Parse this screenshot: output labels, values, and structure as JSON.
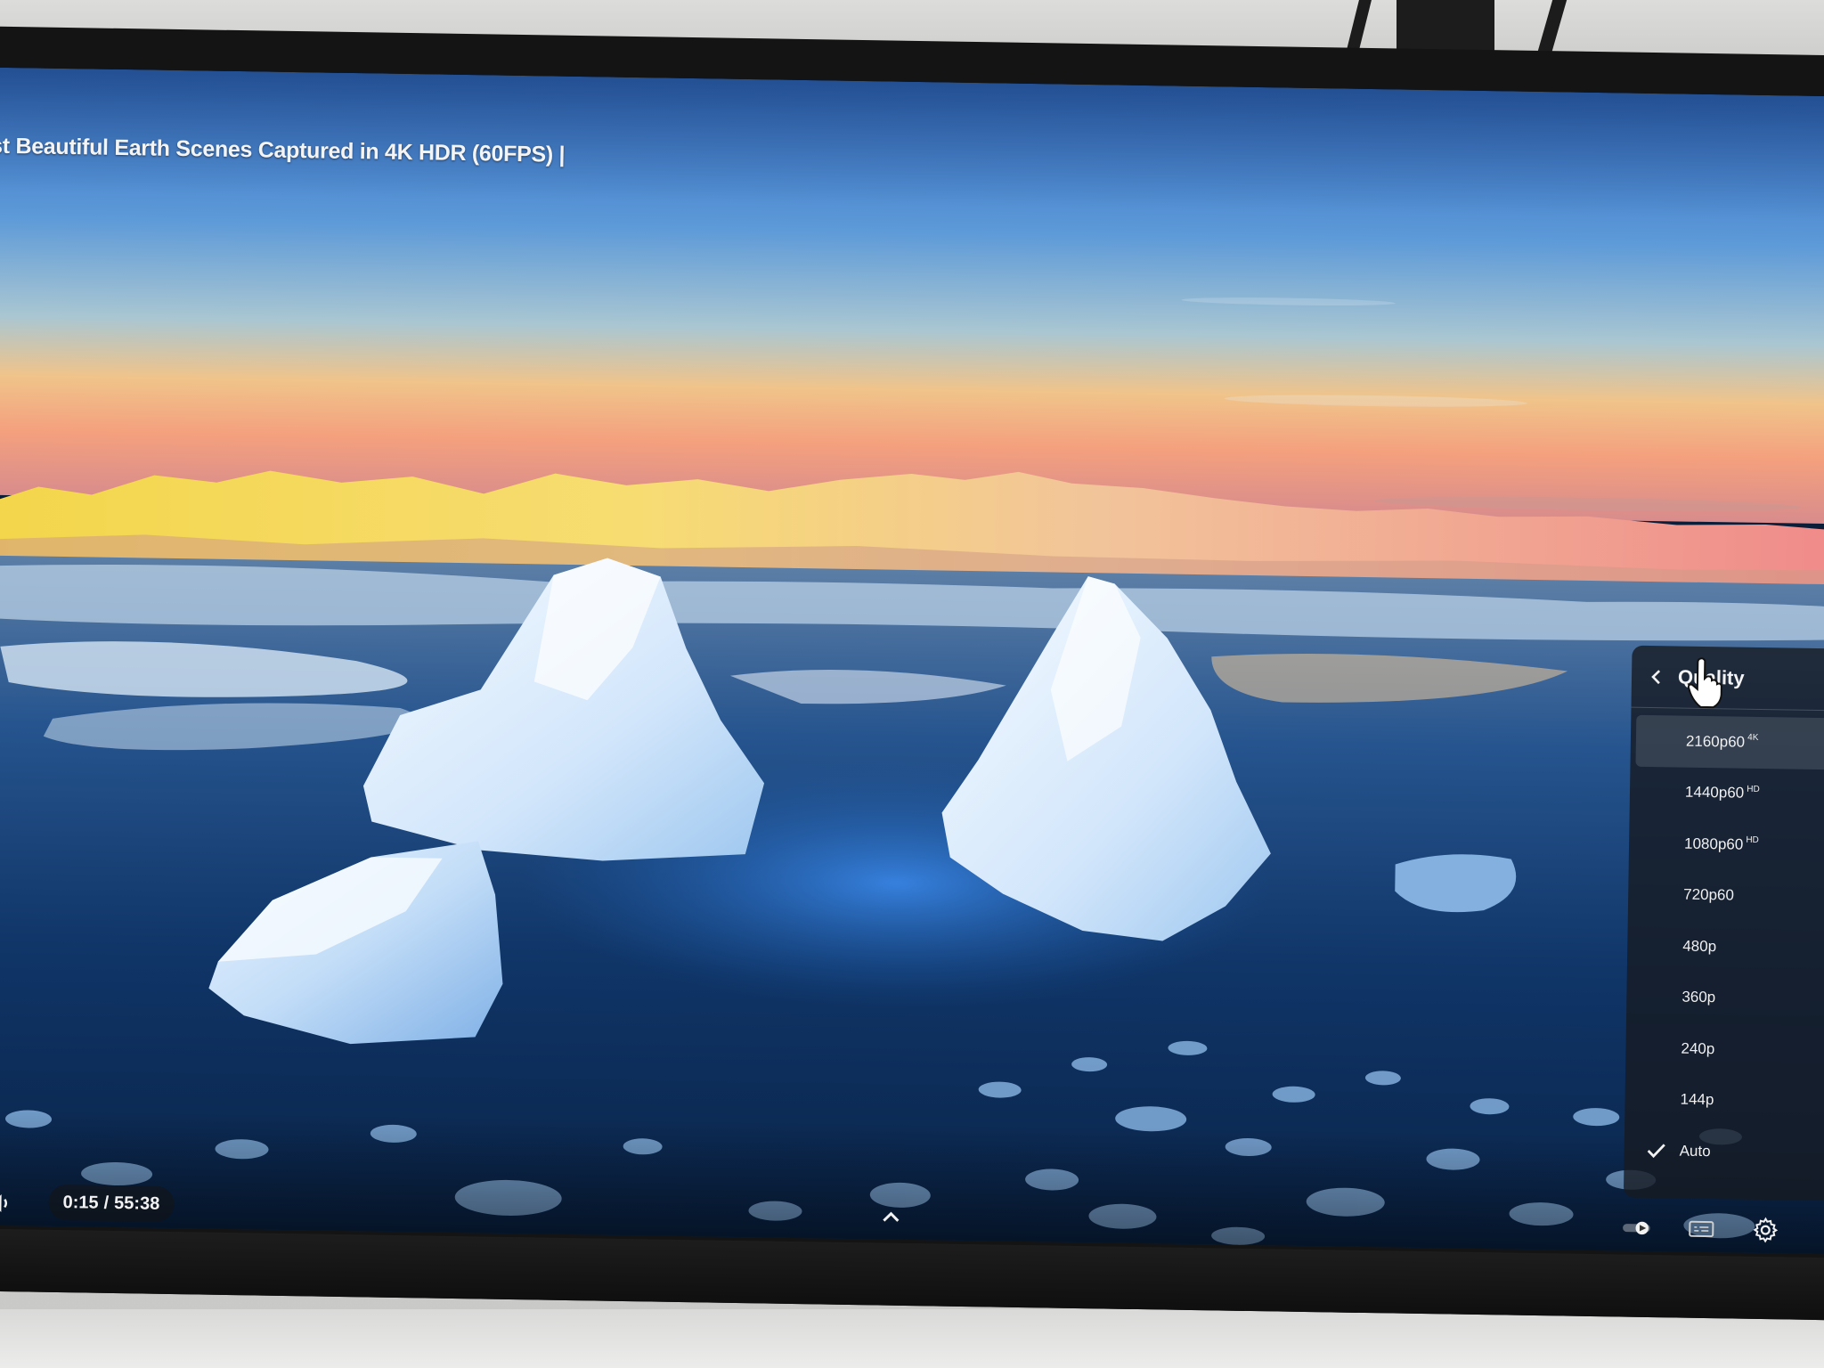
{
  "video": {
    "title": "st Beautiful Earth Scenes Captured in 4K HDR (60FPS) |"
  },
  "player": {
    "time_current": "0:15",
    "time_separator": "/",
    "time_total": "55:38"
  },
  "quality_menu": {
    "title": "Quality",
    "selected": "Auto",
    "highlighted": "2160p60",
    "options": [
      {
        "label": "2160p60",
        "badge": "4K"
      },
      {
        "label": "1440p60",
        "badge": "HD"
      },
      {
        "label": "1080p60",
        "badge": "HD"
      },
      {
        "label": "720p60",
        "badge": ""
      },
      {
        "label": "480p",
        "badge": ""
      },
      {
        "label": "360p",
        "badge": ""
      },
      {
        "label": "240p",
        "badge": ""
      },
      {
        "label": "144p",
        "badge": ""
      },
      {
        "label": "Auto",
        "badge": ""
      }
    ]
  },
  "icons": {
    "volume": "volume-icon",
    "chevron_up": "chevron-up-icon",
    "back": "chevron-left-icon",
    "check": "check-icon",
    "autoplay": "autoplay-toggle-icon",
    "captions": "captions-icon",
    "settings": "gear-icon",
    "cursor": "hand-cursor-icon"
  },
  "colors": {
    "accent_red": "#e52420",
    "menu_bg": "#161a22",
    "text": "#f4f4f4"
  }
}
